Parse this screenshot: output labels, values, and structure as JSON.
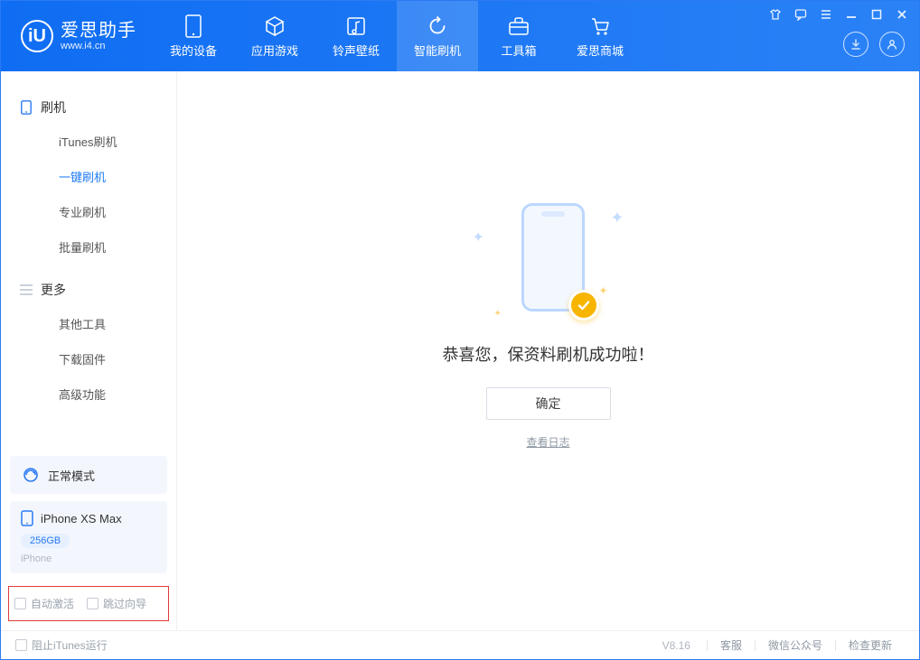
{
  "app": {
    "name": "爱思助手",
    "logo_letter": "iU",
    "website": "www.i4.cn"
  },
  "nav": {
    "tabs": [
      {
        "label": "我的设备",
        "icon": "device-icon"
      },
      {
        "label": "应用游戏",
        "icon": "cube-icon"
      },
      {
        "label": "铃声壁纸",
        "icon": "music-icon"
      },
      {
        "label": "智能刷机",
        "icon": "refresh-icon"
      },
      {
        "label": "工具箱",
        "icon": "toolbox-icon"
      },
      {
        "label": "爱思商城",
        "icon": "cart-icon"
      }
    ],
    "active_index": 3
  },
  "sidebar": {
    "groups": [
      {
        "title": "刷机",
        "icon": "phone-icon",
        "items": [
          {
            "label": "iTunes刷机"
          },
          {
            "label": "一键刷机"
          },
          {
            "label": "专业刷机"
          },
          {
            "label": "批量刷机"
          }
        ],
        "active_item_index": 1
      },
      {
        "title": "更多",
        "icon": "hamburger-icon",
        "items": [
          {
            "label": "其他工具"
          },
          {
            "label": "下载固件"
          },
          {
            "label": "高级功能"
          }
        ],
        "active_item_index": -1
      }
    ],
    "mode_card": {
      "label": "正常模式"
    },
    "device_card": {
      "name": "iPhone XS Max",
      "capacity": "256GB",
      "model": "iPhone"
    },
    "checks": {
      "auto_activate": "自动激活",
      "skip_guide": "跳过向导"
    }
  },
  "main": {
    "success_message": "恭喜您，保资料刷机成功啦！",
    "ok_label": "确定",
    "log_link": "查看日志"
  },
  "footer": {
    "block_itunes": "阻止iTunes运行",
    "version": "V8.16",
    "links": [
      {
        "label": "客服"
      },
      {
        "label": "微信公众号"
      },
      {
        "label": "检查更新"
      }
    ]
  }
}
